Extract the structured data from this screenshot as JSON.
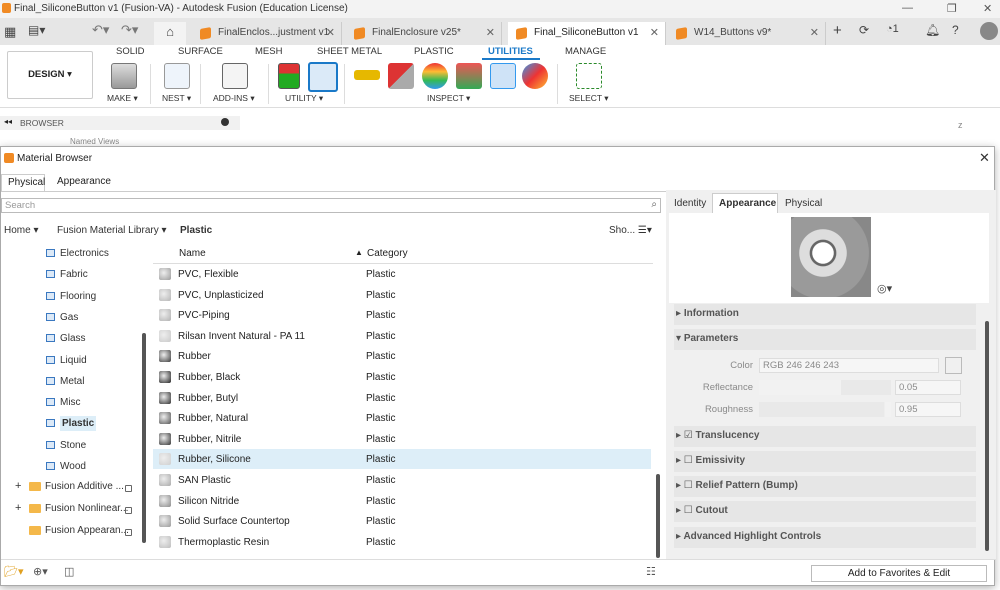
{
  "window": {
    "title": "Final_SiliconeButton v1 (Fusion-VA) - Autodesk Fusion (Education License)"
  },
  "doc_tabs": [
    {
      "label": "FinalEnclos...justment v1",
      "active": false
    },
    {
      "label": "FinalEnclosure v25*",
      "active": false
    },
    {
      "label": "Final_SiliconeButton v1",
      "active": true
    },
    {
      "label": "W14_Buttons v9*",
      "active": false
    }
  ],
  "tabbar_right": {
    "jobs_count": "1"
  },
  "ribbon_tabs": [
    "SOLID",
    "SURFACE",
    "MESH",
    "SHEET METAL",
    "PLASTIC",
    "UTILITIES",
    "MANAGE"
  ],
  "ribbon": {
    "workspace": "DESIGN",
    "groups": [
      "MAKE",
      "NEST",
      "ADD-INS",
      "UTILITY",
      "INSPECT",
      "SELECT"
    ]
  },
  "browser": {
    "title": "BROWSER",
    "named_views": "Named Views"
  },
  "material_browser": {
    "title": "Material Browser",
    "tabs": [
      "Physical",
      "Appearance"
    ],
    "search_placeholder": "Search",
    "breadcrumb": {
      "home": "Home",
      "library": "Fusion Material Library",
      "current": "Plastic",
      "show": "Sho..."
    },
    "tree": [
      "Electronics",
      "Fabric",
      "Flooring",
      "Gas",
      "Glass",
      "Liquid",
      "Metal",
      "Misc",
      "Plastic",
      "Stone",
      "Wood"
    ],
    "libraries": [
      "Fusion Additive ...",
      "Fusion Nonlinear...",
      "Fusion Appearan..."
    ],
    "list_headers": {
      "name": "Name",
      "category": "Category"
    },
    "materials": [
      {
        "name": "PVC, Flexible",
        "category": "Plastic"
      },
      {
        "name": "PVC, Unplasticized",
        "category": "Plastic"
      },
      {
        "name": "PVC-Piping",
        "category": "Plastic"
      },
      {
        "name": "Rilsan Invent Natural - PA 11",
        "category": "Plastic"
      },
      {
        "name": "Rubber",
        "category": "Plastic"
      },
      {
        "name": "Rubber, Black",
        "category": "Plastic"
      },
      {
        "name": "Rubber, Butyl",
        "category": "Plastic"
      },
      {
        "name": "Rubber, Natural",
        "category": "Plastic"
      },
      {
        "name": "Rubber, Nitrile",
        "category": "Plastic"
      },
      {
        "name": "Rubber, Silicone",
        "category": "Plastic"
      },
      {
        "name": "SAN Plastic",
        "category": "Plastic"
      },
      {
        "name": "Silicon Nitride",
        "category": "Plastic"
      },
      {
        "name": "Solid Surface Countertop",
        "category": "Plastic"
      },
      {
        "name": "Thermoplastic Resin",
        "category": "Plastic"
      }
    ],
    "detail_tabs": [
      "Identity",
      "Appearance",
      "Physical"
    ],
    "sections": {
      "information": "Information",
      "parameters": "Parameters",
      "translucency": "Translucency",
      "emissivity": "Emissivity",
      "relief": "Relief Pattern (Bump)",
      "cutout": "Cutout",
      "advanced": "Advanced Highlight Controls"
    },
    "params": {
      "color_label": "Color",
      "color_value": "RGB 246 246 243",
      "reflectance_label": "Reflectance",
      "reflectance_value": "0.05",
      "roughness_label": "Roughness",
      "roughness_value": "0.95"
    },
    "footer_button": "Add to Favorites & Edit"
  },
  "colors": {
    "accent": "#1a79c8",
    "selected_row": "#ddeef8",
    "orange": "#f08a24"
  }
}
